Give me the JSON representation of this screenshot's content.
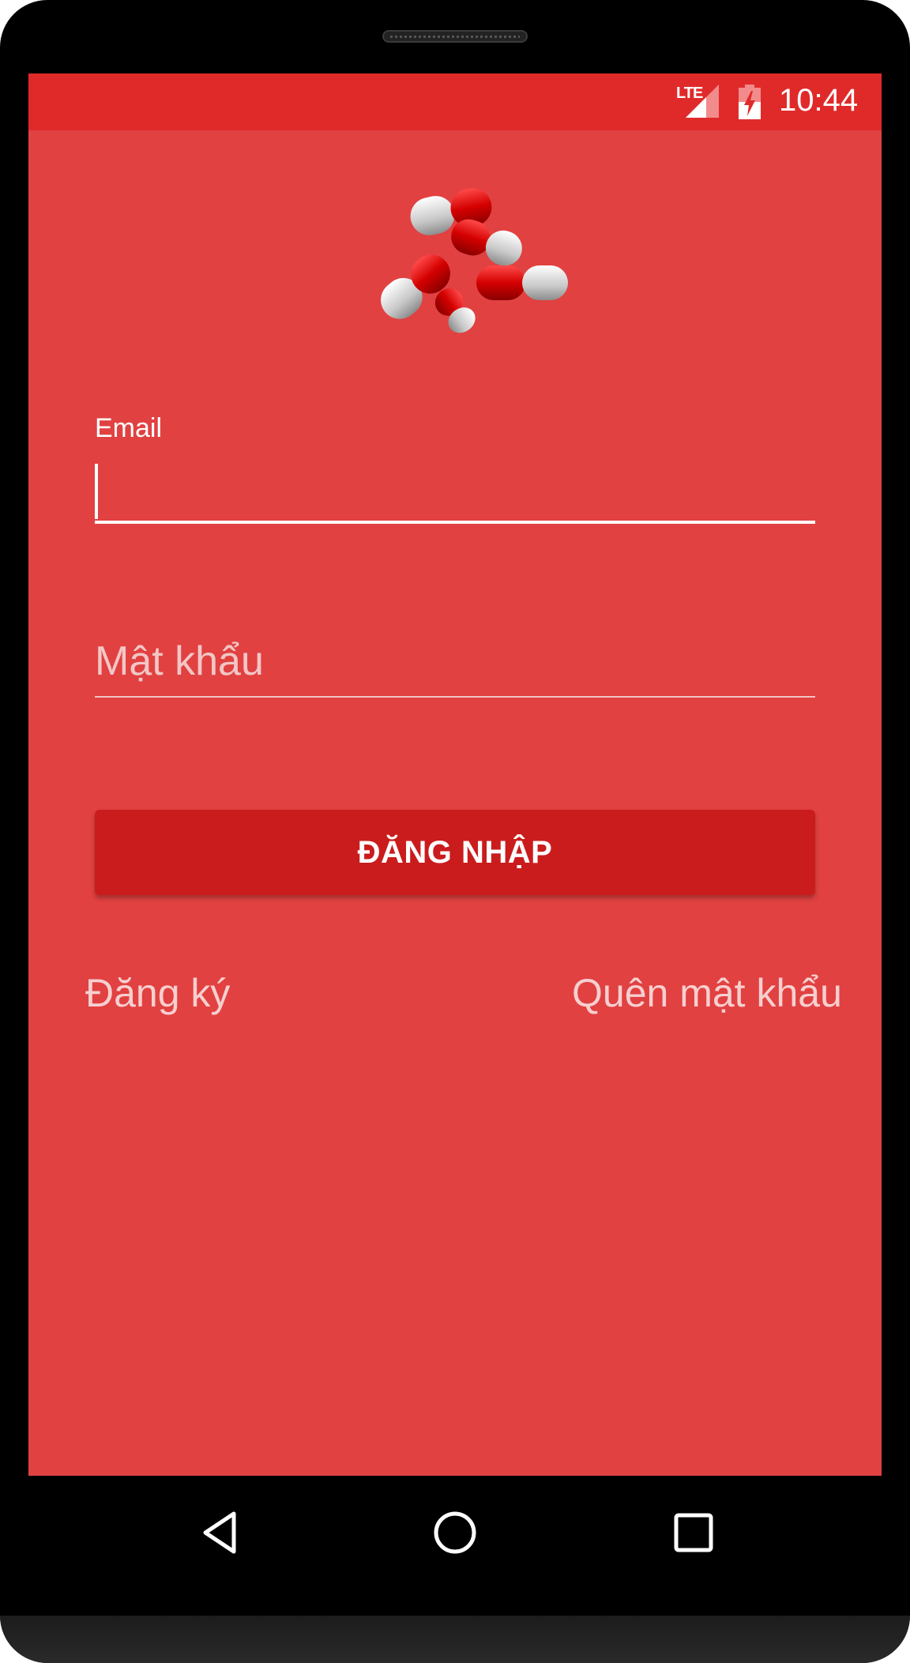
{
  "status_bar": {
    "network": "LTE",
    "time": "10:44",
    "signal_icon": "signal-icon",
    "battery_icon": "battery-charging-icon"
  },
  "logo": {
    "icon": "pills-icon"
  },
  "form": {
    "email_label": "Email",
    "email_value": "",
    "password_placeholder": "Mật khẩu",
    "password_value": "",
    "login_label": "ĐĂNG NHẬP"
  },
  "links": {
    "register": "Đăng ký",
    "forgot_password": "Quên mật khẩu"
  },
  "nav": {
    "back_icon": "back-icon",
    "home_icon": "home-icon",
    "recent_icon": "recent-apps-icon"
  },
  "colors": {
    "background": "#e14141",
    "status_bar": "#e02a2a",
    "button": "#ca1c1c",
    "link_text": "#f7cfcf"
  }
}
